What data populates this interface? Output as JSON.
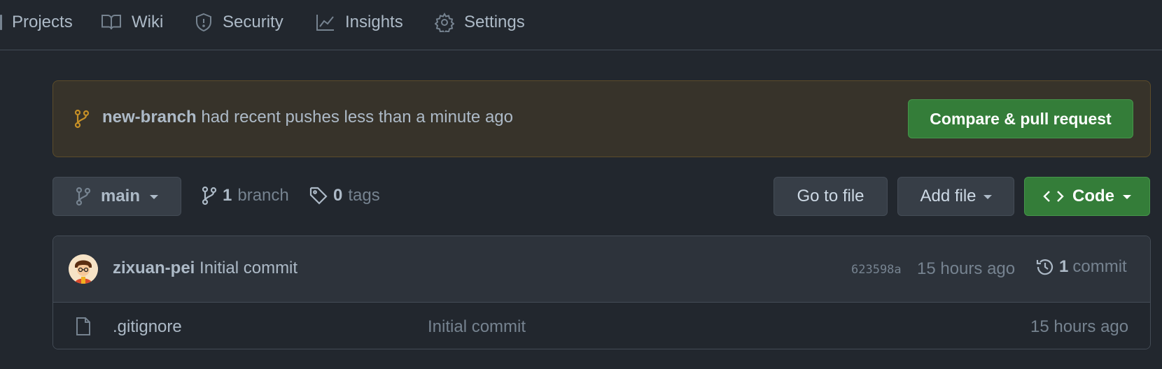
{
  "nav": {
    "items": [
      {
        "label": "Projects",
        "icon": "projects-icon"
      },
      {
        "label": "Wiki",
        "icon": "book-icon"
      },
      {
        "label": "Security",
        "icon": "shield-icon"
      },
      {
        "label": "Insights",
        "icon": "graph-icon"
      },
      {
        "label": "Settings",
        "icon": "gear-icon"
      }
    ]
  },
  "banner": {
    "branch": "new-branch",
    "message": "had recent pushes less than a minute ago",
    "button_label": "Compare & pull request"
  },
  "toolbar": {
    "branch_selector": "main",
    "branch_count": "1",
    "branch_label": "branch",
    "tag_count": "0",
    "tag_label": "tags",
    "go_to_file": "Go to file",
    "add_file": "Add file",
    "code": "Code"
  },
  "latest_commit": {
    "author": "zixuan-pei",
    "message": "Initial commit",
    "hash": "623598a",
    "time": "15 hours ago",
    "commit_count": "1",
    "commit_label": "commit"
  },
  "files": [
    {
      "name": ".gitignore",
      "message": "Initial commit",
      "time": "15 hours ago",
      "icon": "file-icon"
    }
  ],
  "colors": {
    "background": "#22272e",
    "banner_bg": "#37332a",
    "green_button": "#347d39",
    "branch_icon_accent": "#c69026"
  }
}
